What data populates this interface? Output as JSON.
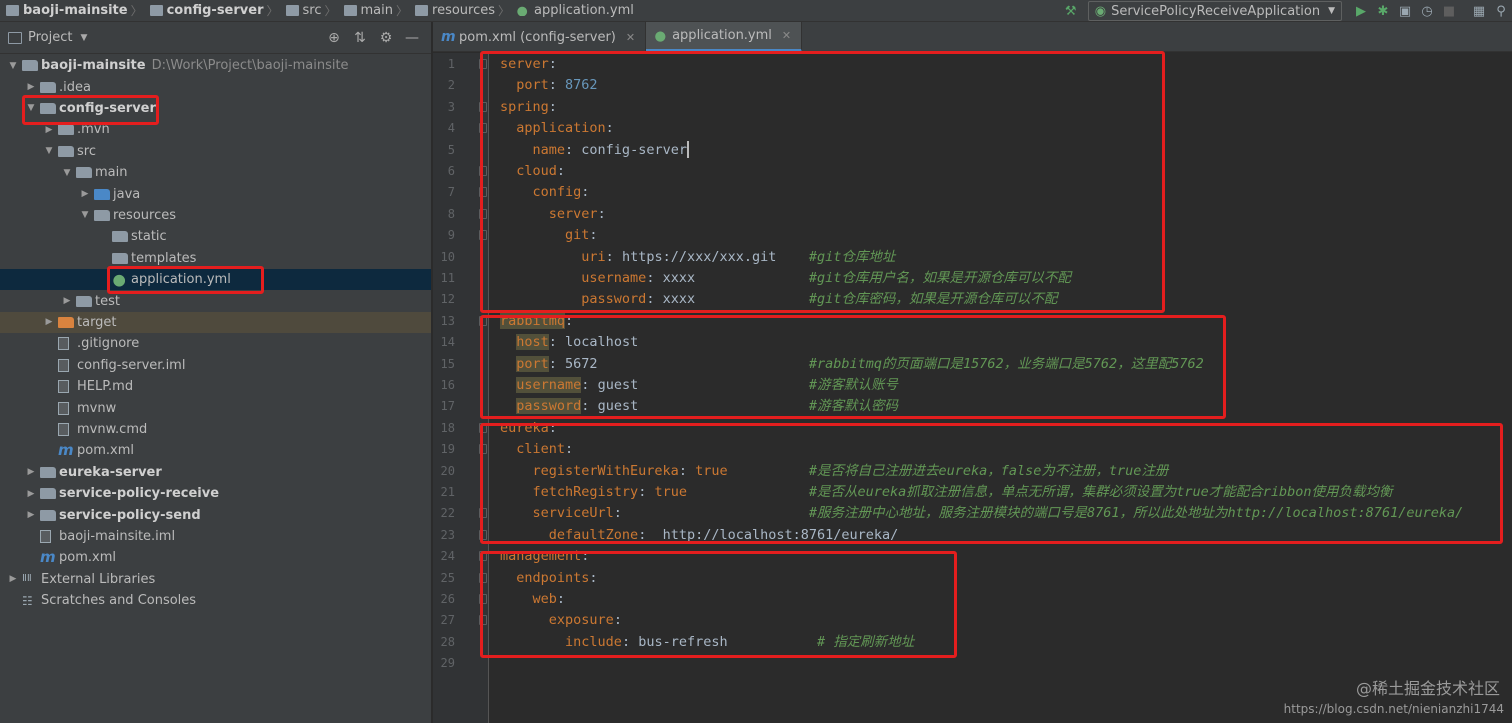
{
  "breadcrumbs": [
    {
      "label": "baoji-mainsite",
      "bold": true
    },
    {
      "label": "config-server",
      "bold": true
    },
    {
      "label": "src",
      "bold": false
    },
    {
      "label": "main",
      "bold": false
    },
    {
      "label": "resources",
      "bold": false
    },
    {
      "label": "application.yml",
      "bold": false
    }
  ],
  "run_config": {
    "label": "ServicePolicyReceiveApplication"
  },
  "project_panel": {
    "title": "Project"
  },
  "tree": [
    {
      "label": "baoji-mainsite",
      "path": "D:\\Work\\Project\\baoji-mainsite",
      "depth": 0,
      "arrow": "down",
      "bold": true,
      "icon": "module-folder-icon"
    },
    {
      "label": ".idea",
      "depth": 1,
      "arrow": "right",
      "icon": "folder-icon"
    },
    {
      "label": "config-server",
      "depth": 1,
      "arrow": "down",
      "bold": true,
      "icon": "module-folder-icon"
    },
    {
      "label": ".mvn",
      "depth": 2,
      "arrow": "right",
      "icon": "folder-icon"
    },
    {
      "label": "src",
      "depth": 2,
      "arrow": "down",
      "icon": "folder-icon"
    },
    {
      "label": "main",
      "depth": 3,
      "arrow": "down",
      "icon": "folder-icon"
    },
    {
      "label": "java",
      "depth": 4,
      "arrow": "right",
      "icon": "source-folder-icon"
    },
    {
      "label": "resources",
      "depth": 4,
      "arrow": "down",
      "icon": "resources-folder-icon"
    },
    {
      "label": "static",
      "depth": 5,
      "arrow": "",
      "icon": "folder-icon"
    },
    {
      "label": "templates",
      "depth": 5,
      "arrow": "",
      "icon": "folder-icon"
    },
    {
      "label": "application.yml",
      "depth": 5,
      "arrow": "",
      "icon": "yaml-file-icon",
      "selected": true
    },
    {
      "label": "test",
      "depth": 3,
      "arrow": "right",
      "icon": "folder-icon"
    },
    {
      "label": "target",
      "depth": 2,
      "arrow": "right",
      "icon": "excluded-folder-icon",
      "excluded": true
    },
    {
      "label": ".gitignore",
      "depth": 2,
      "arrow": "",
      "icon": "gitignore-file-icon"
    },
    {
      "label": "config-server.iml",
      "depth": 2,
      "arrow": "",
      "icon": "iml-file-icon"
    },
    {
      "label": "HELP.md",
      "depth": 2,
      "arrow": "",
      "icon": "markdown-file-icon"
    },
    {
      "label": "mvnw",
      "depth": 2,
      "arrow": "",
      "icon": "shell-file-icon"
    },
    {
      "label": "mvnw.cmd",
      "depth": 2,
      "arrow": "",
      "icon": "cmd-file-icon"
    },
    {
      "label": "pom.xml",
      "depth": 2,
      "arrow": "",
      "icon": "maven-file-icon"
    },
    {
      "label": "eureka-server",
      "depth": 1,
      "arrow": "right",
      "bold": true,
      "icon": "module-folder-icon"
    },
    {
      "label": "service-policy-receive",
      "depth": 1,
      "arrow": "right",
      "bold": true,
      "icon": "module-folder-icon"
    },
    {
      "label": "service-policy-send",
      "depth": 1,
      "arrow": "right",
      "bold": true,
      "icon": "module-folder-icon"
    },
    {
      "label": "baoji-mainsite.iml",
      "depth": 1,
      "arrow": "",
      "icon": "iml-file-icon"
    },
    {
      "label": "pom.xml",
      "depth": 1,
      "arrow": "",
      "icon": "maven-file-icon"
    },
    {
      "label": "External Libraries",
      "depth": 0,
      "arrow": "right",
      "icon": "libraries-icon"
    },
    {
      "label": "Scratches and Consoles",
      "depth": 0,
      "arrow": "",
      "icon": "scratches-icon"
    }
  ],
  "tabs": [
    {
      "label": "pom.xml (config-server)",
      "icon": "maven-file-icon",
      "active": false
    },
    {
      "label": "application.yml",
      "icon": "yaml-file-icon",
      "active": true
    }
  ],
  "code_lines": [
    {
      "n": "1",
      "indent": 0,
      "key": "server",
      "sep": ":",
      "value": "",
      "vtype": "",
      "comment": ""
    },
    {
      "n": "2",
      "indent": 1,
      "key": "port",
      "sep": ": ",
      "value": "8762",
      "vtype": "num",
      "comment": ""
    },
    {
      "n": "3",
      "indent": 0,
      "key": "spring",
      "sep": ":",
      "value": "",
      "vtype": "",
      "comment": ""
    },
    {
      "n": "4",
      "indent": 1,
      "key": "application",
      "sep": ":",
      "value": "",
      "vtype": "",
      "comment": ""
    },
    {
      "n": "5",
      "indent": 2,
      "key": "name",
      "sep": ": ",
      "value": "config-server",
      "vtype": "str",
      "comment": "",
      "cursor": true
    },
    {
      "n": "6",
      "indent": 1,
      "key": "cloud",
      "sep": ":",
      "value": "",
      "vtype": "",
      "comment": ""
    },
    {
      "n": "7",
      "indent": 2,
      "key": "config",
      "sep": ":",
      "value": "",
      "vtype": "",
      "comment": ""
    },
    {
      "n": "8",
      "indent": 3,
      "key": "server",
      "sep": ":",
      "value": "",
      "vtype": "",
      "comment": ""
    },
    {
      "n": "9",
      "indent": 4,
      "key": "git",
      "sep": ":",
      "value": "",
      "vtype": "",
      "comment": ""
    },
    {
      "n": "10",
      "indent": 5,
      "key": "uri",
      "sep": ": ",
      "value": "https://xxx/xxx.git",
      "vtype": "str",
      "comment": "#git仓库地址"
    },
    {
      "n": "11",
      "indent": 5,
      "key": "username",
      "sep": ": ",
      "value": "xxxx",
      "vtype": "str",
      "comment": "#git仓库用户名，如果是开源仓库可以不配"
    },
    {
      "n": "12",
      "indent": 5,
      "key": "password",
      "sep": ": ",
      "value": "xxxx",
      "vtype": "str",
      "comment": "#git仓库密码，如果是开源仓库可以不配"
    },
    {
      "n": "13",
      "indent": 0,
      "key": "rabbitmq",
      "sep": ":",
      "value": "",
      "vtype": "",
      "comment": "",
      "hl": true
    },
    {
      "n": "14",
      "indent": 1,
      "key": "host",
      "sep": ": ",
      "value": "localhost",
      "vtype": "str",
      "comment": "",
      "hl": true
    },
    {
      "n": "15",
      "indent": 1,
      "key": "port",
      "sep": ": ",
      "value": "5672",
      "vtype": "str",
      "comment": "#rabbitmq的页面端口是15762，业务端口是5762，这里配5762",
      "hl": true
    },
    {
      "n": "16",
      "indent": 1,
      "key": "username",
      "sep": ": ",
      "value": "guest",
      "vtype": "str",
      "comment": "#游客默认账号",
      "hl": true
    },
    {
      "n": "17",
      "indent": 1,
      "key": "password",
      "sep": ": ",
      "value": "guest",
      "vtype": "str",
      "comment": "#游客默认密码",
      "hl": true
    },
    {
      "n": "18",
      "indent": 0,
      "key": "eureka",
      "sep": ":",
      "value": "",
      "vtype": "",
      "comment": ""
    },
    {
      "n": "19",
      "indent": 1,
      "key": "client",
      "sep": ":",
      "value": "",
      "vtype": "",
      "comment": ""
    },
    {
      "n": "20",
      "indent": 2,
      "key": "registerWithEureka",
      "sep": ": ",
      "value": "true",
      "vtype": "kw",
      "comment": "#是否将自己注册进去eureka，false为不注册，true注册"
    },
    {
      "n": "21",
      "indent": 2,
      "key": "fetchRegistry",
      "sep": ": ",
      "value": "true",
      "vtype": "kw",
      "comment": "#是否从eureka抓取注册信息，单点无所谓，集群必须设置为true才能配合ribbon使用负载均衡"
    },
    {
      "n": "22",
      "indent": 2,
      "key": "serviceUrl",
      "sep": ":",
      "value": "",
      "vtype": "",
      "comment": "#服务注册中心地址，服务注册模块的端口号是8761，所以此处地址为http://localhost:8761/eureka/"
    },
    {
      "n": "23",
      "indent": 3,
      "key": "defaultZone",
      "sep": ":  ",
      "value": "http://localhost:8761/eureka/",
      "vtype": "str",
      "comment": ""
    },
    {
      "n": "24",
      "indent": 0,
      "key": "management",
      "sep": ":",
      "value": "",
      "vtype": "",
      "comment": ""
    },
    {
      "n": "25",
      "indent": 1,
      "key": "endpoints",
      "sep": ":",
      "value": "",
      "vtype": "",
      "comment": ""
    },
    {
      "n": "26",
      "indent": 2,
      "key": "web",
      "sep": ":",
      "value": "",
      "vtype": "",
      "comment": ""
    },
    {
      "n": "27",
      "indent": 3,
      "key": "exposure",
      "sep": ":",
      "value": "",
      "vtype": "",
      "comment": ""
    },
    {
      "n": "28",
      "indent": 4,
      "key": "include",
      "sep": ": ",
      "value": "bus-refresh",
      "vtype": "str",
      "comment": "# 指定刷新地址",
      "comment_col": 39
    },
    {
      "n": "29",
      "indent": 0,
      "key": "",
      "sep": "",
      "value": "",
      "vtype": "",
      "comment": ""
    }
  ],
  "watermark": {
    "line1": "@稀土掘金技术社区",
    "line2": "https://blog.csdn.net/nienianzhi1744"
  },
  "colors": {
    "highlight_box": "#e41e1e",
    "selection": "#0d293e",
    "keyword": "#cc7832",
    "comment": "#629755",
    "number": "#6897bb"
  }
}
